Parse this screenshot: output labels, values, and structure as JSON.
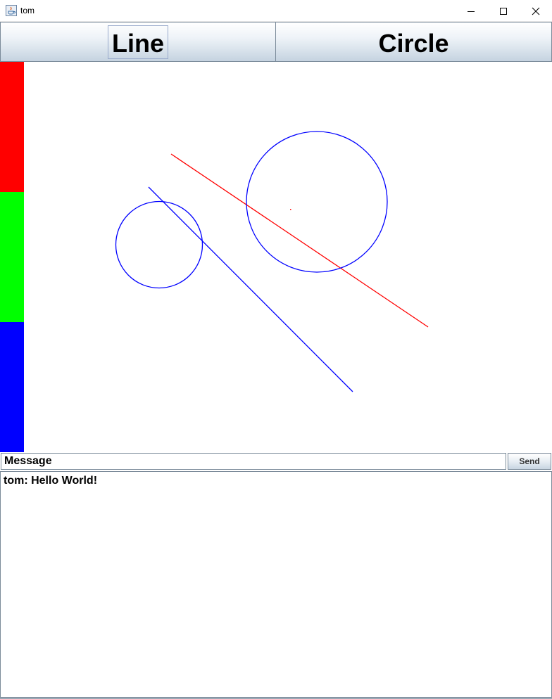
{
  "window": {
    "title": "tom",
    "icon": "java-cup-icon",
    "controls": [
      "minimize-icon",
      "maximize-icon",
      "close-icon"
    ]
  },
  "toolbar": {
    "line_label": "Line",
    "circle_label": "Circle",
    "focused": "Line"
  },
  "palette": {
    "colors": [
      "#ff0000",
      "#00ff00",
      "#0000ff"
    ]
  },
  "drawing": {
    "shapes": [
      {
        "type": "line",
        "color": "#ff0000"
      },
      {
        "type": "line",
        "color": "#0000ff"
      },
      {
        "type": "circle",
        "color": "#0000ff"
      },
      {
        "type": "circle",
        "color": "#0000ff"
      },
      {
        "type": "dot",
        "color": "#ff0000"
      }
    ]
  },
  "message": {
    "value": "Message",
    "send_label": "Send"
  },
  "chat": {
    "lines": [
      "tom: Hello World!"
    ]
  }
}
